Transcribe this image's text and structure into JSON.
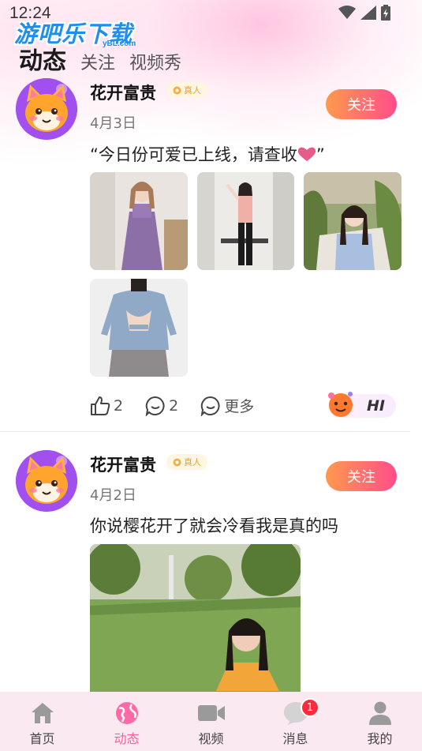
{
  "status_bar": {
    "time": "12:24"
  },
  "watermark": {
    "text": "游吧乐下载",
    "sub": "yBL.com"
  },
  "tabs": [
    {
      "label": "动态",
      "active": true
    },
    {
      "label": "关注",
      "active": false
    },
    {
      "label": "视频秀",
      "active": false
    }
  ],
  "posts": [
    {
      "username": "花开富贵",
      "badge": "真人",
      "date": "4月3日",
      "follow_label": "关注",
      "text": "“今日份可爱已上线，请查收",
      "text_end": "”",
      "likes": "2",
      "comments": "2",
      "more_label": "更多",
      "hi_label": "HI"
    },
    {
      "username": "花开富贵",
      "badge": "真人",
      "date": "4月2日",
      "follow_label": "关注",
      "text": "你说樱花开了就会冷看我是真的吗"
    }
  ],
  "bottom_nav": [
    {
      "label": "首页",
      "icon": "home-icon",
      "active": false
    },
    {
      "label": "动态",
      "icon": "globe-icon",
      "active": true
    },
    {
      "label": "视频",
      "icon": "video-camera-icon",
      "active": false
    },
    {
      "label": "消息",
      "icon": "chat-bubble-icon",
      "active": false,
      "badge": "1"
    },
    {
      "label": "我的",
      "icon": "user-icon",
      "active": false
    }
  ],
  "colors": {
    "accent": "#ff5c9d",
    "follow_gradient_start": "#ff9a4d",
    "follow_gradient_end": "#ff4d8a",
    "badge_text": "#e8a136",
    "nav_bg": "#fbe9f1"
  }
}
